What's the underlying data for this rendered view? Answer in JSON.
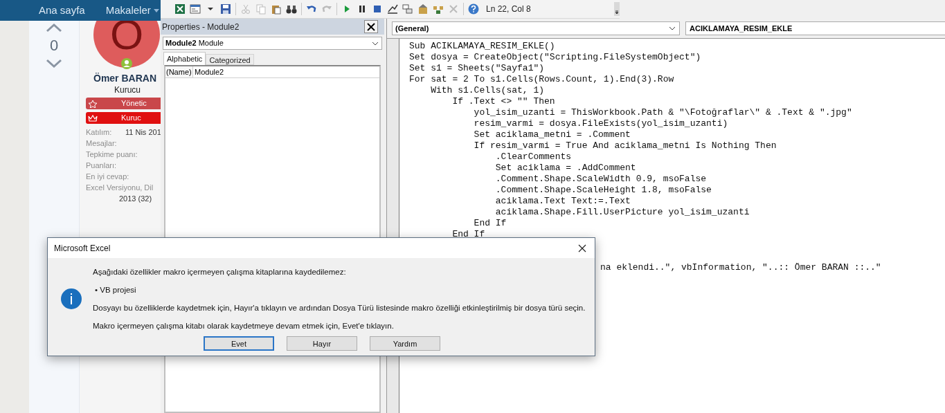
{
  "forum": {
    "nav": [
      {
        "label": "Ana sayfa",
        "has_caret": false
      },
      {
        "label": "Makaleler",
        "has_caret": true
      }
    ],
    "vote": {
      "score": "0"
    },
    "profile": {
      "avatar_letter": "O",
      "name": "Ömer BARAN",
      "title": "Kurucu",
      "badges": [
        {
          "label": "Yönetic",
          "kind": "star",
          "color": "#c9474a"
        },
        {
          "label": "Kuruc",
          "kind": "crown",
          "color": "#e01010"
        }
      ],
      "stats": [
        {
          "label": "Katılım:",
          "value": "11 Nis 201"
        },
        {
          "label": "Mesajlar:"
        },
        {
          "label": "Tepkime puanı:"
        },
        {
          "label": "Puanları:"
        },
        {
          "label": "En iyi cevap:"
        }
      ],
      "extra_label": "Excel Versiyonu, Dil",
      "extra_value": "2013 (32)"
    }
  },
  "vbe": {
    "toolbar": {
      "position": "Ln 22, Col 8"
    },
    "properties": {
      "title": "Properties - Module2",
      "object_name": "Module2",
      "object_type": "Module",
      "tabs": [
        {
          "label": "Alphabetic",
          "selected": true
        },
        {
          "label": "Categorized",
          "selected": false
        }
      ],
      "rows": [
        {
          "name": "(Name)",
          "value": "Module2"
        }
      ]
    },
    "code": {
      "object": "(General)",
      "procedure": "ACIKLAMAYA_RESIM_EKLE",
      "lines": [
        "Sub ACIKLAMAYA_RESIM_EKLE()",
        "Set dosya = CreateObject(\"Scripting.FileSystemObject\")",
        "Set s1 = Sheets(\"Sayfa1\")",
        "For sat = 2 To s1.Cells(Rows.Count, 1).End(3).Row",
        "    With s1.Cells(sat, 1)",
        "        If .Text <> \"\" Then",
        "            yol_isim_uzanti = ThisWorkbook.Path & \"\\Fotoğraflar\\\" & .Text & \".jpg\"",
        "            resim_varmi = dosya.FileExists(yol_isim_uzanti)",
        "            Set aciklama_metni = .Comment",
        "            If resim_varmi = True And aciklama_metni Is Nothing Then",
        "                .ClearComments",
        "                Set aciklama = .AddComment",
        "                .Comment.Shape.ScaleWidth 0.9, msoFalse",
        "                .Comment.Shape.ScaleHeight 1.8, msoFalse",
        "                aciklama.Text Text:=.Text",
        "                aciklama.Shape.Fill.UserPicture yol_isim_uzanti",
        "            End If",
        "        End If"
      ],
      "tail_line": "na eklendi..\", vbInformation, \"..:: Ömer BARAN ::..\""
    }
  },
  "dialog": {
    "title": "Microsoft Excel",
    "intro": "Aşağıdaki özellikler makro içermeyen çalışma kitaplarına kaydedilemez:",
    "bullet": "• VB projesi",
    "paragraphs": [
      "Dosyayı bu özelliklerde kaydetmek için, Hayır'a tıklayın ve ardından Dosya Türü listesinde makro özelliği etkinleştirilmiş bir dosya türü seçin.",
      "Makro içermeyen çalışma kitabı olarak kaydetmeye devam etmek için, Evet'e tıklayın."
    ],
    "buttons": [
      {
        "label": "Evet",
        "selected": true
      },
      {
        "label": "Hayır",
        "selected": false
      },
      {
        "label": "Yardım",
        "selected": false
      }
    ]
  }
}
